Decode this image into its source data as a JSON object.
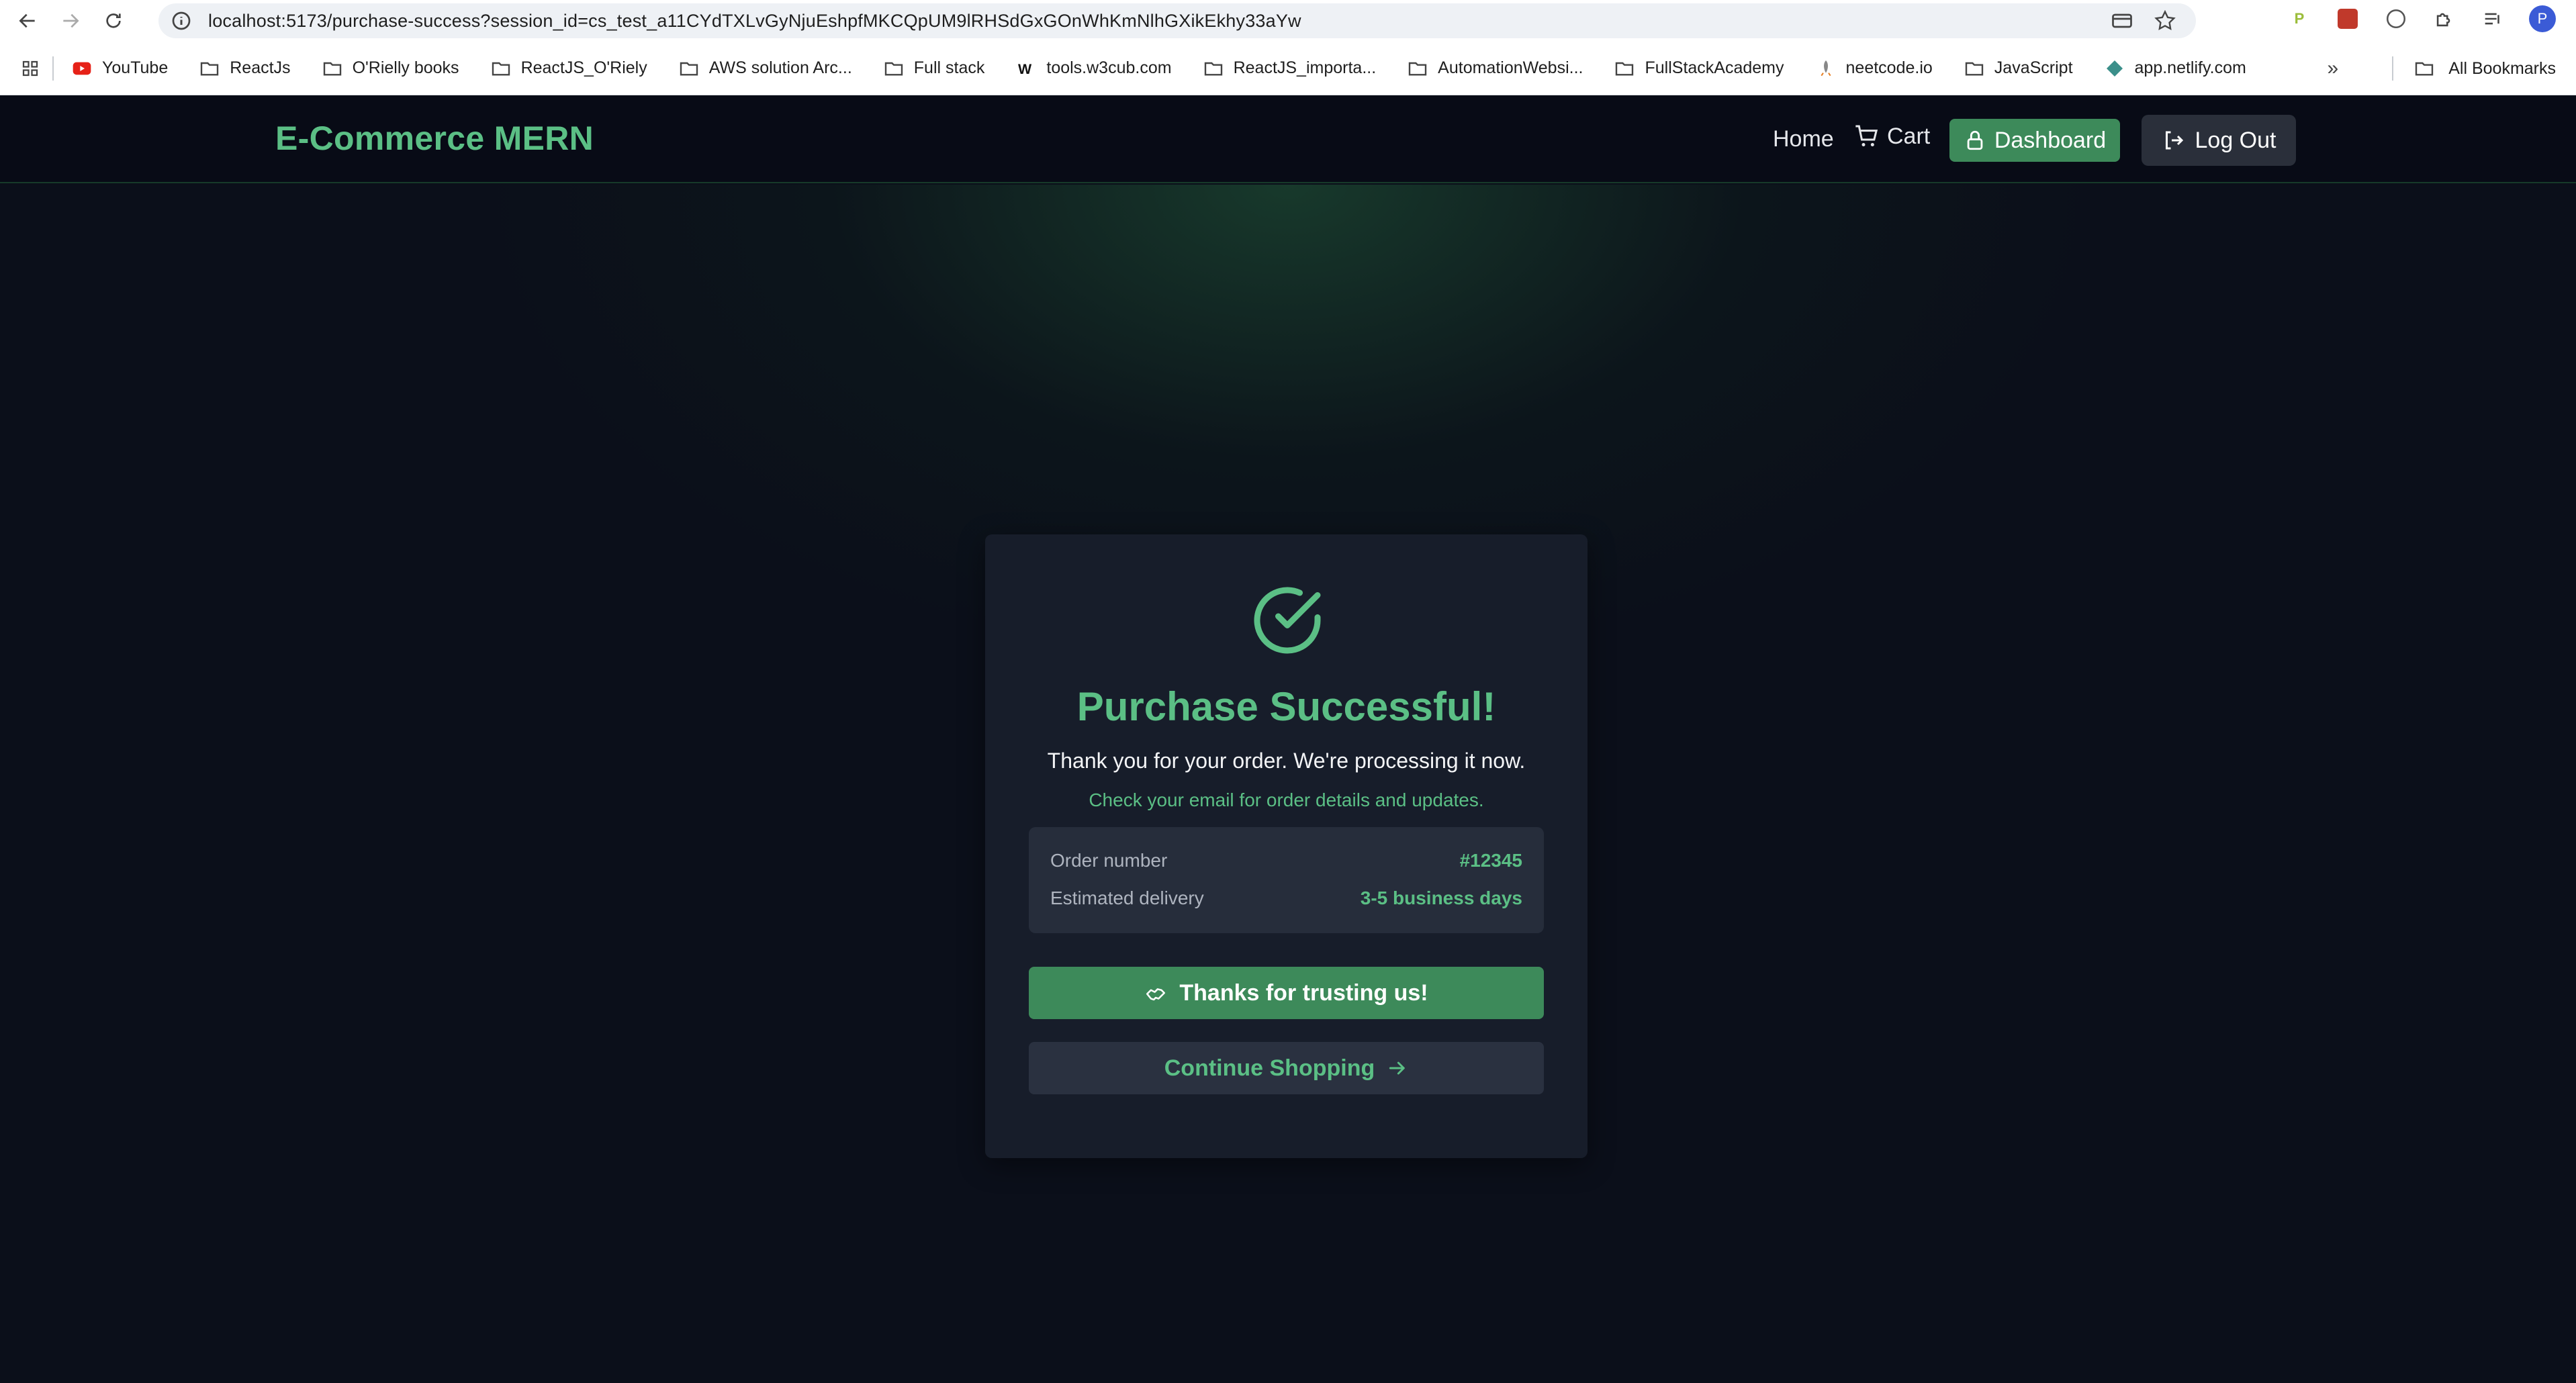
{
  "browser": {
    "url": "localhost:5173/purchase-success?session_id=cs_test_a11CYdTXLvGyNjuEshpfMKCQpUM9lRHSdGxGOnWhKmNlhGXikEkhy33aYw",
    "profile_initial": "P"
  },
  "bookmarks": {
    "items": [
      {
        "label": "YouTube",
        "icon": "youtube-icon"
      },
      {
        "label": "ReactJs",
        "icon": "folder-icon"
      },
      {
        "label": "O'Rielly books",
        "icon": "folder-icon"
      },
      {
        "label": "ReactJS_O'Riely",
        "icon": "folder-icon"
      },
      {
        "label": "AWS solution Arc...",
        "icon": "folder-icon"
      },
      {
        "label": "Full stack",
        "icon": "folder-icon"
      },
      {
        "label": "tools.w3cub.com",
        "icon": "w3cub-icon"
      },
      {
        "label": "ReactJS_importa...",
        "icon": "folder-icon"
      },
      {
        "label": "AutomationWebsi...",
        "icon": "folder-icon"
      },
      {
        "label": "FullStackAcademy",
        "icon": "folder-icon"
      },
      {
        "label": "neetcode.io",
        "icon": "neetcode-icon"
      },
      {
        "label": "JavaScript",
        "icon": "folder-icon"
      },
      {
        "label": "app.netlify.com",
        "icon": "netlify-icon"
      }
    ],
    "all_label": "All Bookmarks"
  },
  "navbar": {
    "brand": "E-Commerce MERN",
    "home": "Home",
    "cart": "Cart",
    "dashboard": "Dashboard",
    "logout": "Log Out"
  },
  "success": {
    "title": "Purchase Successful!",
    "subtitle": "Thank you for your order. We're processing it now.",
    "note": "Check your email for order details and updates.",
    "order_label": "Order number",
    "order_value": "#12345",
    "delivery_label": "Estimated delivery",
    "delivery_value": "3-5 business days",
    "thanks_button": "Thanks for trusting us!",
    "continue_button": "Continue Shopping"
  },
  "colors": {
    "accent": "#5bbf85",
    "button_green": "#3d8a5a",
    "background": "#0b0f1a",
    "card": "#171d2a"
  }
}
